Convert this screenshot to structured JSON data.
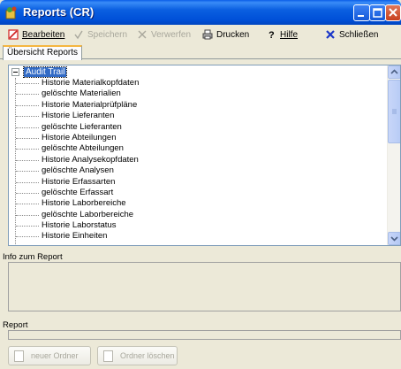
{
  "window": {
    "title": "Reports (CR)"
  },
  "toolbar": {
    "edit_label": "Bearbeiten",
    "save_label": "Speichern",
    "discard_label": "Verwerfen",
    "print_label": "Drucken",
    "help_label": "Hilfe",
    "close_label": "Schließen"
  },
  "tabs": [
    {
      "label": "Übersicht Reports"
    }
  ],
  "tree": {
    "root_label": "Audit Trail",
    "items": [
      "Historie Materialkopfdaten",
      "gelöschte Materialien",
      "Historie Materialprüfpläne",
      "Historie Lieferanten",
      "gelöschte Lieferanten",
      "Historie Abteilungen",
      "gelöschte Abteilungen",
      "Historie Analysekopfdaten",
      "gelöschte Analysen",
      "Historie Erfassarten",
      "gelöschte Erfassart",
      "Historie Laborbereiche",
      "gelöschte Laborbereiche",
      "Historie Laborstatus",
      "Historie Einheiten"
    ]
  },
  "info": {
    "label": "Info zum Report"
  },
  "report": {
    "label": "Report"
  },
  "buttons": {
    "new_folder": "neuer Ordner",
    "delete_folder": "Ordner löschen"
  },
  "colors": {
    "titlebar": "#0a5fe0",
    "selection": "#316ac5",
    "close_icon": "#1a36c8",
    "edit_icon": "#d02020"
  }
}
